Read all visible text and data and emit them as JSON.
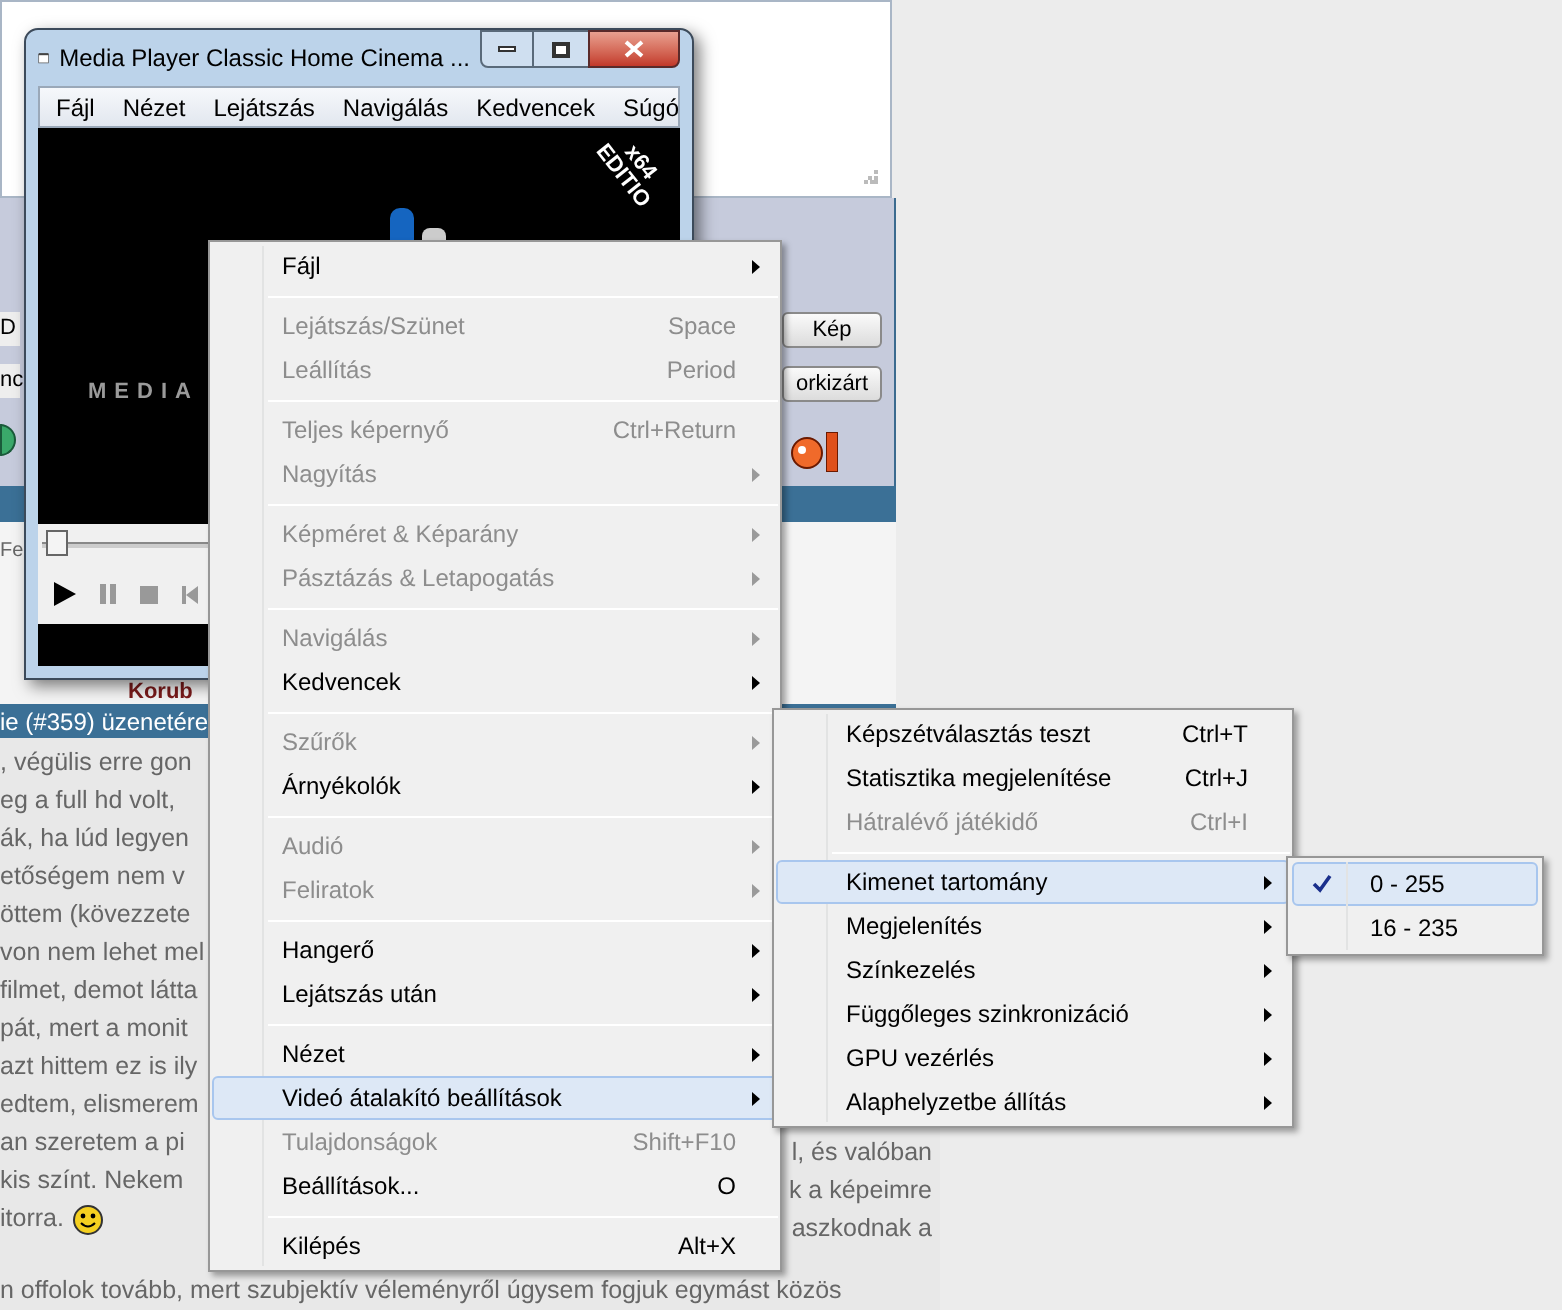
{
  "forum": {
    "button_fragments": [
      "D",
      "nc"
    ],
    "buttons": [
      "Kép",
      "orkizárt"
    ],
    "section_fragment": "Fe",
    "author_fragment": "Korub",
    "reply_header": "ie (#359) üzenetére",
    "post_left_lines": [
      ", végülis erre gon",
      "eg a full hd volt,",
      "ák, ha lúd legyen",
      "etőségem nem v",
      "öttem (kövezzete",
      "von nem lehet mel",
      " filmet, demot látta",
      "pát, mert a monit",
      "azt hittem ez is ily",
      "edtem, elismerem",
      "an szeretem a pi",
      " kis színt. Nekem",
      "itorra."
    ],
    "post_right_lines": [
      "l, és valóban",
      "k a képeimre",
      "aszkodnak a"
    ],
    "post_bottom_line": "n offolok tovább, mert szubjektív véleményről úgysem fogjuk egymást közös"
  },
  "player": {
    "title": "Media Player Classic Home Cinema ...",
    "menu": [
      "Fájl",
      "Nézet",
      "Lejátszás",
      "Navigálás",
      "Kedvencek",
      "Súgó"
    ],
    "logo_text": "MEDIA",
    "edition_lines": [
      "x64",
      "EDITIO"
    ]
  },
  "context_menu": [
    {
      "kind": "item",
      "label": "Fájl",
      "submenu": true,
      "disabled": false,
      "selected": false
    },
    {
      "kind": "separator"
    },
    {
      "kind": "item",
      "label": "Lejátszás/Szünet",
      "shortcut": "Space",
      "submenu": false,
      "disabled": true,
      "selected": false
    },
    {
      "kind": "item",
      "label": "Leállítás",
      "shortcut": "Period",
      "submenu": false,
      "disabled": true,
      "selected": false
    },
    {
      "kind": "separator"
    },
    {
      "kind": "item",
      "label": "Teljes képernyő",
      "shortcut": "Ctrl+Return",
      "submenu": false,
      "disabled": true,
      "selected": false
    },
    {
      "kind": "item",
      "label": "Nagyítás",
      "submenu": true,
      "disabled": true,
      "selected": false
    },
    {
      "kind": "separator"
    },
    {
      "kind": "item",
      "label": "Képméret & Képarány",
      "submenu": true,
      "disabled": true,
      "selected": false
    },
    {
      "kind": "item",
      "label": "Pásztázás & Letapogatás",
      "submenu": true,
      "disabled": true,
      "selected": false
    },
    {
      "kind": "separator"
    },
    {
      "kind": "item",
      "label": "Navigálás",
      "submenu": true,
      "disabled": true,
      "selected": false
    },
    {
      "kind": "item",
      "label": "Kedvencek",
      "submenu": true,
      "disabled": false,
      "selected": false
    },
    {
      "kind": "separator"
    },
    {
      "kind": "item",
      "label": "Szűrők",
      "submenu": true,
      "disabled": true,
      "selected": false
    },
    {
      "kind": "item",
      "label": "Árnyékolók",
      "submenu": true,
      "disabled": false,
      "selected": false
    },
    {
      "kind": "separator"
    },
    {
      "kind": "item",
      "label": "Audió",
      "submenu": true,
      "disabled": true,
      "selected": false
    },
    {
      "kind": "item",
      "label": "Feliratok",
      "submenu": true,
      "disabled": true,
      "selected": false
    },
    {
      "kind": "separator"
    },
    {
      "kind": "item",
      "label": "Hangerő",
      "submenu": true,
      "disabled": false,
      "selected": false
    },
    {
      "kind": "item",
      "label": "Lejátszás után",
      "submenu": true,
      "disabled": false,
      "selected": false
    },
    {
      "kind": "separator"
    },
    {
      "kind": "item",
      "label": "Nézet",
      "submenu": true,
      "disabled": false,
      "selected": false
    },
    {
      "kind": "item",
      "label": "Videó átalakító beállítások",
      "submenu": true,
      "disabled": false,
      "selected": true
    },
    {
      "kind": "item",
      "label": "Tulajdonságok",
      "shortcut": "Shift+F10",
      "submenu": false,
      "disabled": true,
      "selected": false
    },
    {
      "kind": "item",
      "label": "Beállítások...",
      "shortcut": "O",
      "submenu": false,
      "disabled": false,
      "selected": false
    },
    {
      "kind": "separator"
    },
    {
      "kind": "item",
      "label": "Kilépés",
      "shortcut": "Alt+X",
      "submenu": false,
      "disabled": false,
      "selected": false
    }
  ],
  "submenu": [
    {
      "kind": "item",
      "label": "Képszétválasztás teszt",
      "shortcut": "Ctrl+T",
      "submenu": false,
      "disabled": false,
      "selected": false
    },
    {
      "kind": "item",
      "label": "Statisztika megjelenítése",
      "shortcut": "Ctrl+J",
      "submenu": false,
      "disabled": false,
      "selected": false
    },
    {
      "kind": "item",
      "label": "Hátralévő játékidő",
      "shortcut": "Ctrl+I",
      "submenu": false,
      "disabled": true,
      "selected": false
    },
    {
      "kind": "separator"
    },
    {
      "kind": "item",
      "label": "Kimenet tartomány",
      "submenu": true,
      "disabled": false,
      "selected": true
    },
    {
      "kind": "item",
      "label": "Megjelenítés",
      "submenu": true,
      "disabled": false,
      "selected": false
    },
    {
      "kind": "item",
      "label": "Színkezelés",
      "submenu": true,
      "disabled": false,
      "selected": false
    },
    {
      "kind": "item",
      "label": "Függőleges szinkronizáció",
      "submenu": true,
      "disabled": false,
      "selected": false
    },
    {
      "kind": "item",
      "label": "GPU vezérlés",
      "submenu": true,
      "disabled": false,
      "selected": false
    },
    {
      "kind": "item",
      "label": "Alaphelyzetbe állítás",
      "submenu": true,
      "disabled": false,
      "selected": false
    }
  ],
  "range_menu": [
    {
      "label": "0 - 255",
      "checked": true,
      "selected": true
    },
    {
      "label": "16 - 235",
      "checked": false,
      "selected": false
    }
  ]
}
